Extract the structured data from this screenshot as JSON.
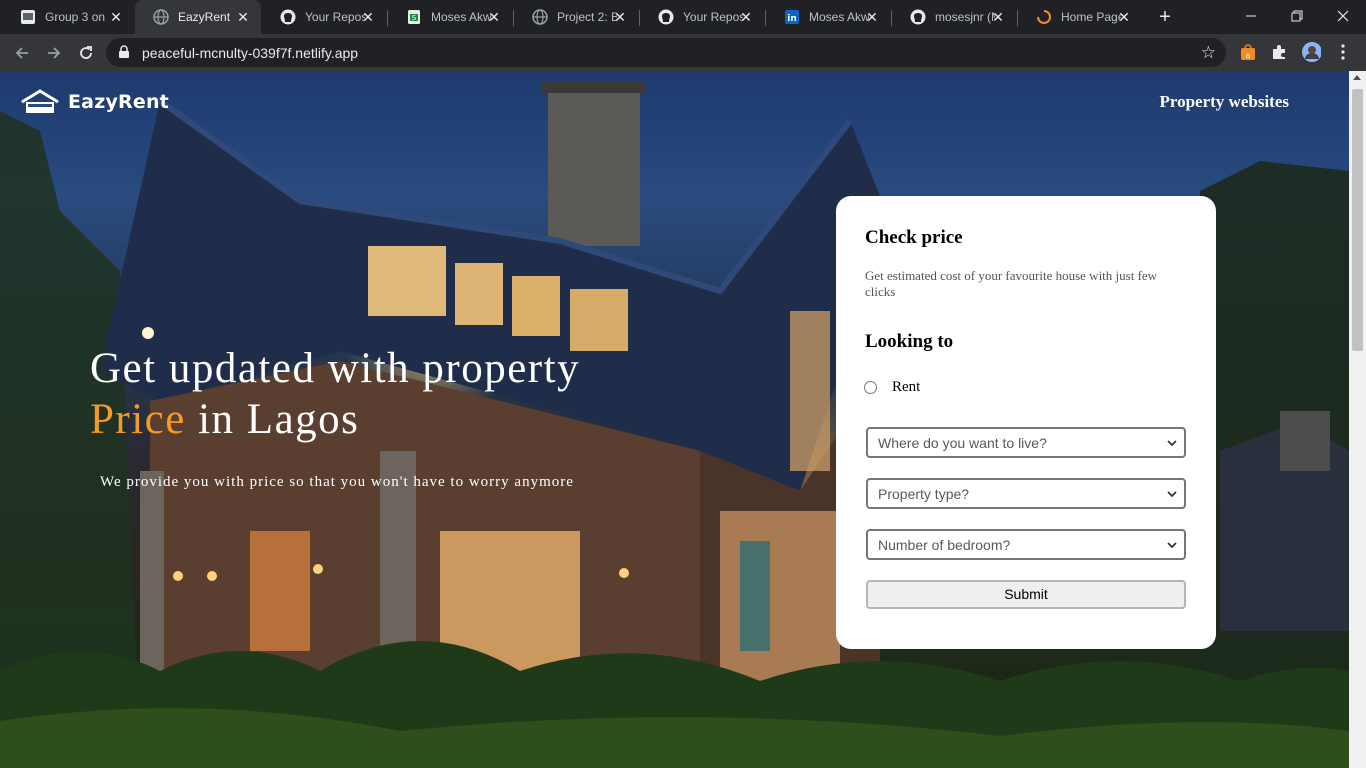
{
  "browser": {
    "tabs": [
      {
        "title": "Group 3 on",
        "icon": "slides-icon",
        "active": false
      },
      {
        "title": "EazyRent",
        "icon": "globe-icon",
        "active": true
      },
      {
        "title": "Your Reposi",
        "icon": "github-icon",
        "active": false
      },
      {
        "title": "Moses Akw",
        "icon": "sheets-icon",
        "active": false
      },
      {
        "title": "Project 2: B",
        "icon": "globe-icon",
        "active": false
      },
      {
        "title": "Your Reposi",
        "icon": "github-icon",
        "active": false
      },
      {
        "title": "Moses Akw",
        "icon": "linkedin-icon",
        "active": false
      },
      {
        "title": "mosesjnr (M",
        "icon": "github-icon",
        "active": false
      },
      {
        "title": "Home Page",
        "icon": "loading-icon",
        "active": false
      }
    ],
    "close_glyph": "✕",
    "new_tab_glyph": "+",
    "url": "peaceful-mcnulty-039f7f.netlify.app"
  },
  "page": {
    "logo_text": "EazyRent",
    "nav_link": "Property websites",
    "headline_line1": "Get updated with property",
    "headline_accent": "Price",
    "headline_rest": " in Lagos",
    "subline": "We provide you with price so that you won't have to worry anymore",
    "accent_color": "#f59b23"
  },
  "card": {
    "title": "Check price",
    "description": "Get estimated cost of your favourite house with just few clicks",
    "looking_to": "Looking to",
    "radio_label": "Rent",
    "selects": [
      {
        "placeholder": "Where do you want to live?"
      },
      {
        "placeholder": "Property type?"
      },
      {
        "placeholder": "Number of bedroom?"
      }
    ],
    "submit_label": "Submit"
  }
}
